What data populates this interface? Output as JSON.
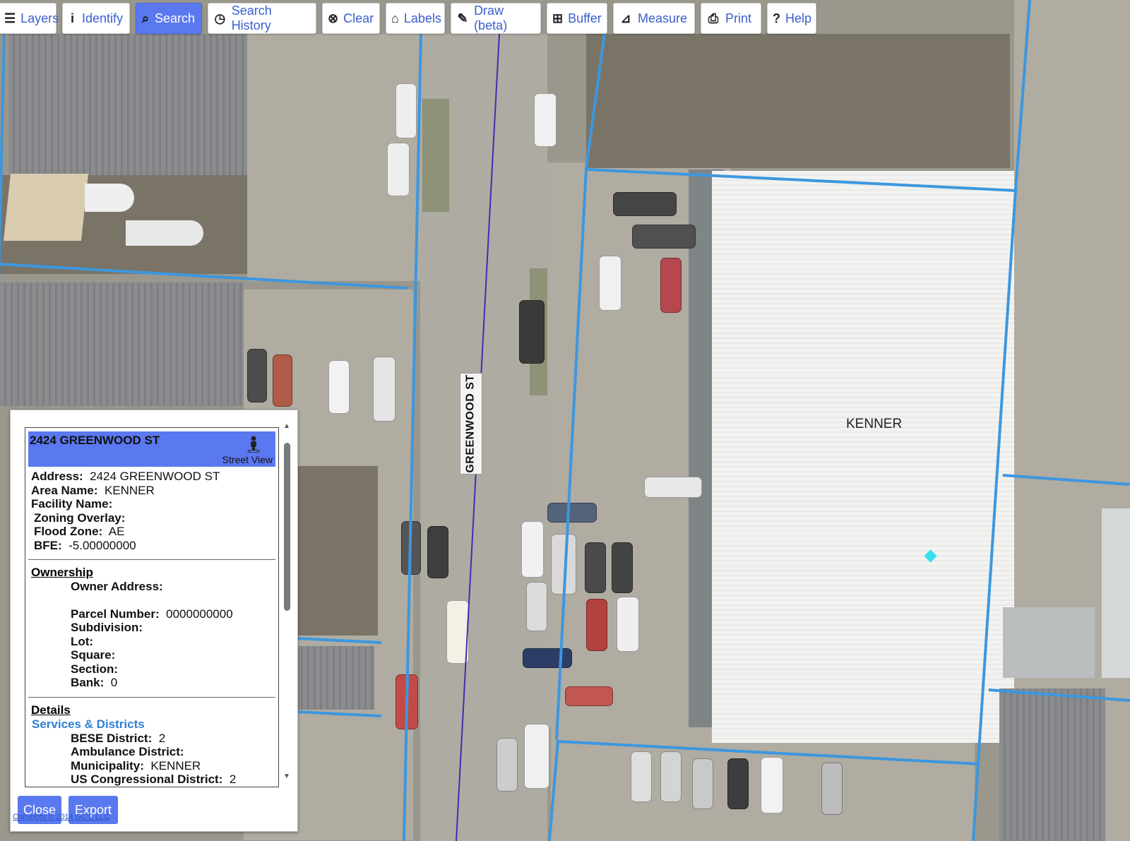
{
  "toolbar": {
    "buttons": [
      {
        "label": "Layers",
        "icon": "menu-icon"
      },
      {
        "label": "Identify",
        "icon": "info-icon"
      },
      {
        "label": "Search",
        "icon": "search-icon",
        "active": true
      },
      {
        "label": "Search History",
        "icon": "clock-icon"
      },
      {
        "label": "Clear",
        "icon": "clear-icon"
      },
      {
        "label": "Labels",
        "icon": "labels-icon"
      },
      {
        "label": "Draw (beta)",
        "icon": "pencil-icon"
      },
      {
        "label": "Buffer",
        "icon": "buffer-icon"
      },
      {
        "label": "Measure",
        "icon": "ruler-icon"
      },
      {
        "label": "Print",
        "icon": "printer-icon"
      },
      {
        "label": "Help",
        "icon": "help-icon"
      }
    ],
    "active_color": "#5a78ef"
  },
  "map": {
    "street_label": "GREENWOOD ST",
    "area_label": "KENNER",
    "parcel_line_color": "#3d97de",
    "selected_point_color": "#38e0f0"
  },
  "popup": {
    "title": "2424 GREENWOOD ST",
    "street_view_label": "Street View",
    "fields": [
      {
        "label": "Address:",
        "value": "2424 GREENWOOD ST"
      },
      {
        "label": "Area Name:",
        "value": "KENNER"
      },
      {
        "label": "Facility Name:",
        "value": ""
      },
      {
        "label": "Zoning Overlay:",
        "value": ""
      },
      {
        "label": "Flood Zone:",
        "value": "AE"
      },
      {
        "label": "BFE:",
        "value": "-5.00000000"
      }
    ],
    "ownership": {
      "title": "Ownership",
      "owner_address_label": "Owner Address:",
      "fields": [
        {
          "label": "Parcel Number:",
          "value": "0000000000"
        },
        {
          "label": "Subdivision:",
          "value": ""
        },
        {
          "label": "Lot:",
          "value": ""
        },
        {
          "label": "Square:",
          "value": ""
        },
        {
          "label": "Section:",
          "value": ""
        },
        {
          "label": "Bank:",
          "value": "0"
        }
      ]
    },
    "details": {
      "title": "Details",
      "subtitle": "Services & Districts",
      "fields": [
        {
          "label": "BESE District:",
          "value": "2"
        },
        {
          "label": "Ambulance District:",
          "value": ""
        },
        {
          "label": "Municipality:",
          "value": "KENNER"
        },
        {
          "label": "US Congressional District:",
          "value": "2"
        }
      ]
    },
    "buttons": {
      "close": "Close",
      "export": "Export"
    }
  },
  "copyright": "Copyright © 2014 GCT, LLC"
}
